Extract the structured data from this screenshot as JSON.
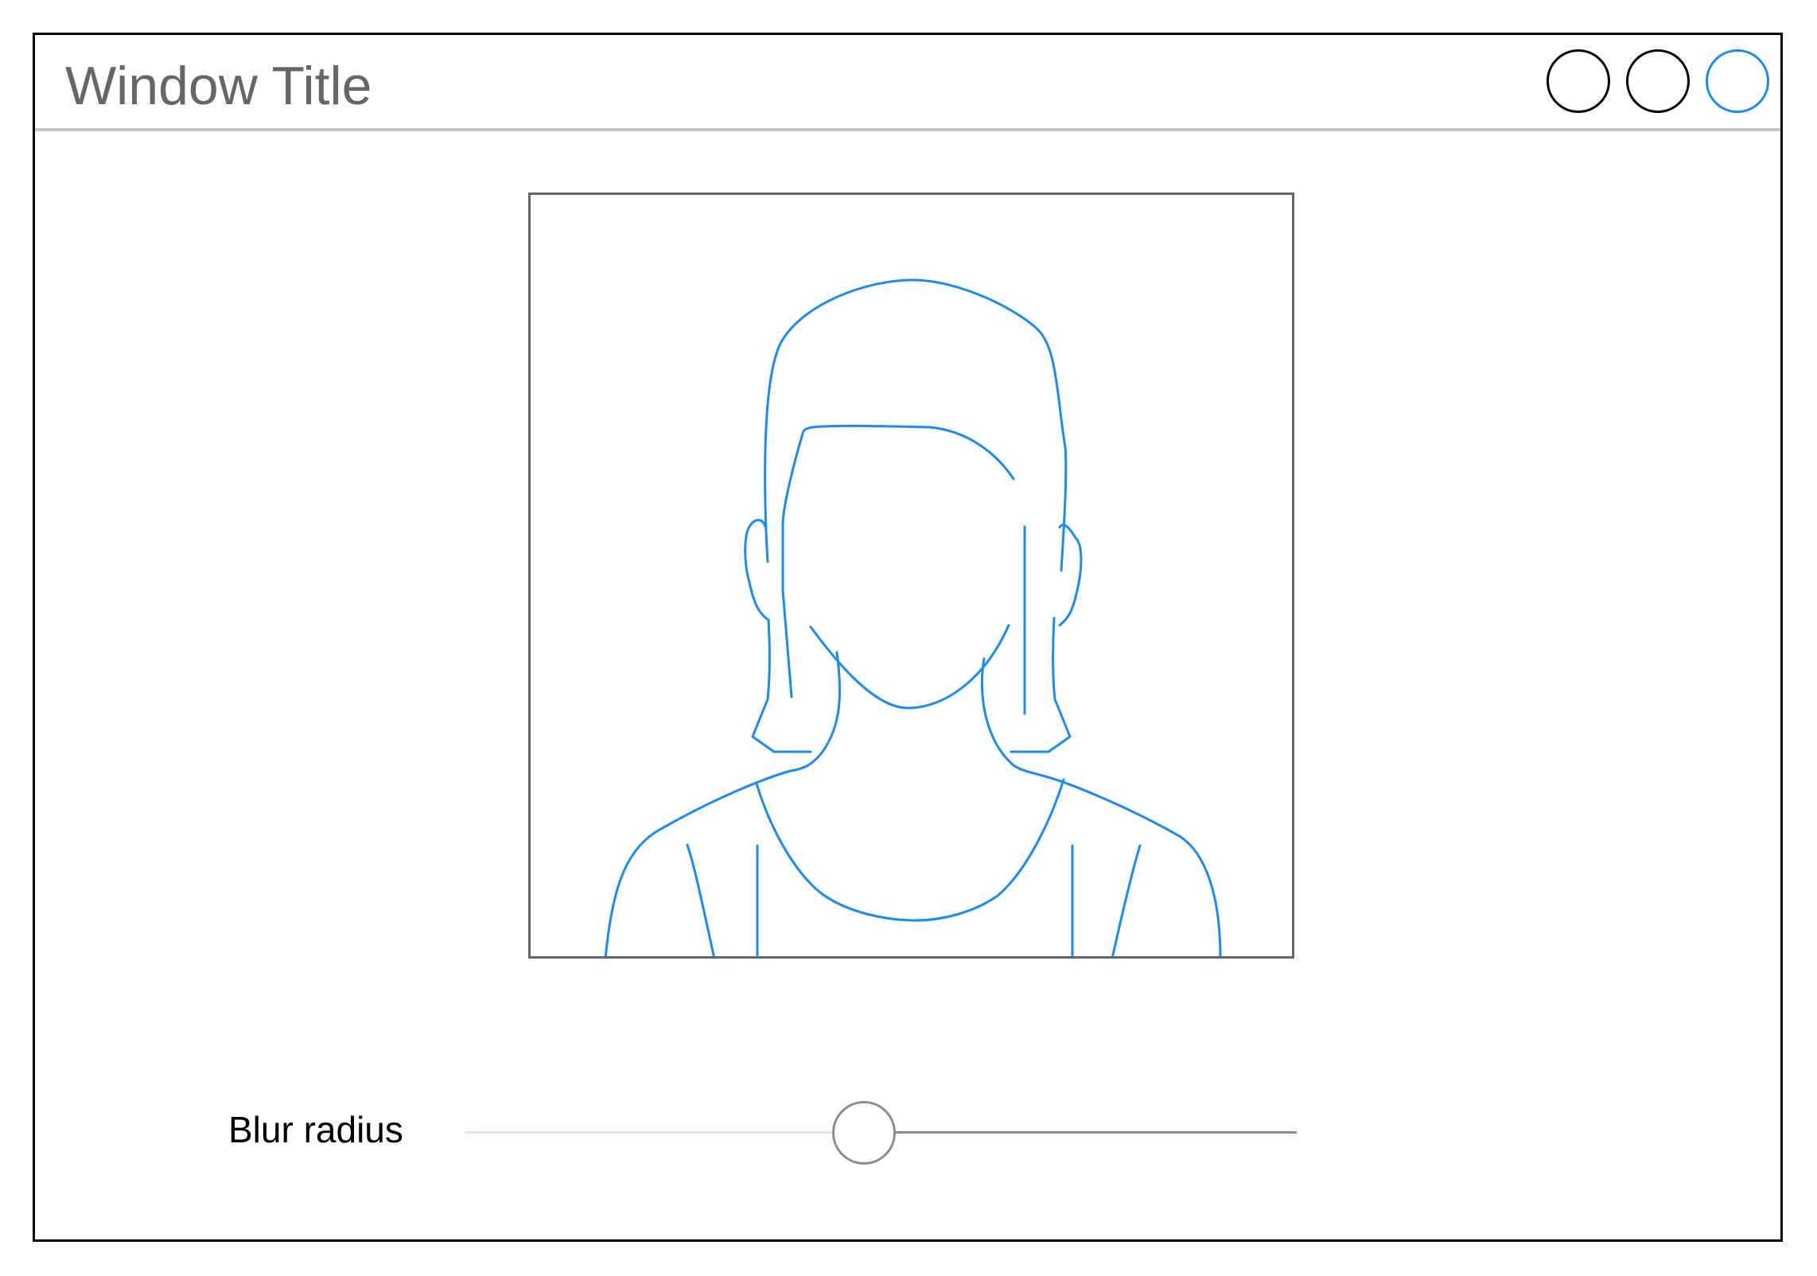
{
  "window": {
    "title": "Window Title",
    "controls": [
      "minimize",
      "maximize",
      "close"
    ]
  },
  "image": {
    "icon": "person-silhouette-icon",
    "stroke_color": "#1a8cef"
  },
  "blur_control": {
    "label": "Blur radius",
    "value_fraction": 0.48
  },
  "colors": {
    "accent": "#1a8cef",
    "title_text": "#666666",
    "border": "#000000"
  }
}
